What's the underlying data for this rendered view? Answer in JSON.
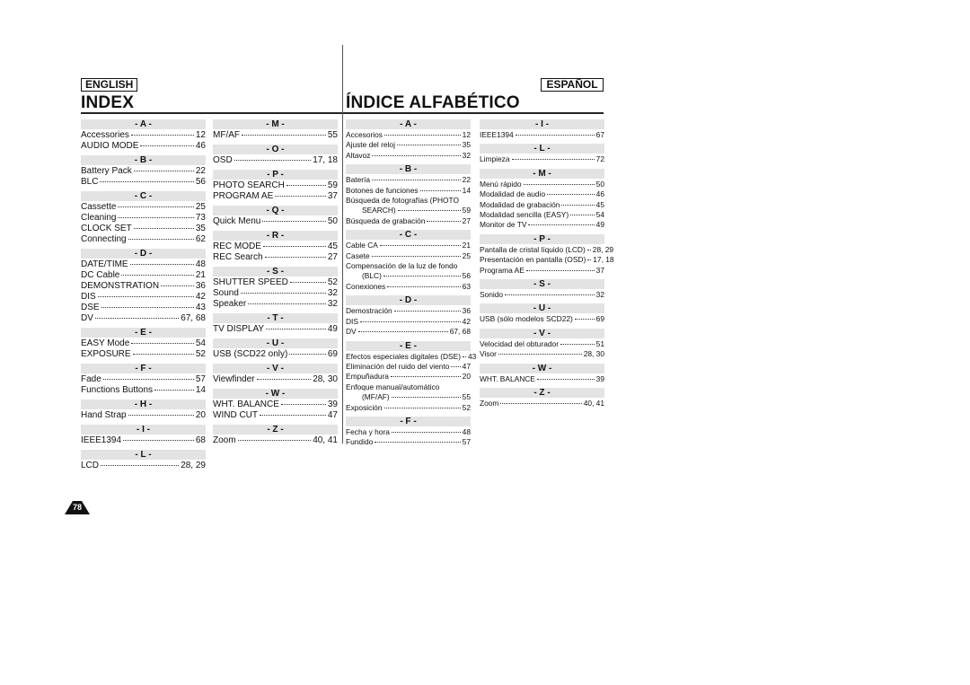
{
  "english": {
    "lang_label": "ENGLISH",
    "title": "INDEX",
    "columns": [
      [
        {
          "letter": "- A -",
          "items": [
            [
              "Accessories",
              "12"
            ],
            [
              "AUDIO MODE",
              "46"
            ]
          ]
        },
        {
          "letter": "- B -",
          "items": [
            [
              "Battery Pack",
              "22"
            ],
            [
              "BLC",
              "56"
            ]
          ]
        },
        {
          "letter": "- C -",
          "items": [
            [
              "Cassette",
              "25"
            ],
            [
              "Cleaning",
              "73"
            ],
            [
              "CLOCK SET",
              "35"
            ],
            [
              "Connecting",
              "62"
            ]
          ]
        },
        {
          "letter": "- D -",
          "items": [
            [
              "DATE/TIME",
              "48"
            ],
            [
              "DC Cable",
              "21"
            ],
            [
              "DEMONSTRATION",
              "36"
            ],
            [
              "DIS",
              "42"
            ],
            [
              "DSE",
              "43"
            ],
            [
              "DV",
              "67, 68"
            ]
          ]
        },
        {
          "letter": "- E -",
          "items": [
            [
              "EASY Mode",
              "54"
            ],
            [
              "EXPOSURE",
              "52"
            ]
          ]
        },
        {
          "letter": "- F -",
          "items": [
            [
              "Fade",
              "57"
            ],
            [
              "Functions Buttons",
              "14"
            ]
          ]
        },
        {
          "letter": "- H -",
          "items": [
            [
              "Hand Strap",
              "20"
            ]
          ]
        },
        {
          "letter": "- I -",
          "items": [
            [
              "IEEE1394",
              "68"
            ]
          ]
        },
        {
          "letter": "- L -",
          "items": [
            [
              "LCD",
              "28, 29"
            ]
          ]
        }
      ],
      [
        {
          "letter": "- M -",
          "items": [
            [
              "MF/AF",
              "55"
            ]
          ]
        },
        {
          "letter": "- O -",
          "items": [
            [
              "OSD",
              "17, 18"
            ]
          ]
        },
        {
          "letter": "- P -",
          "items": [
            [
              "PHOTO SEARCH",
              "59"
            ],
            [
              "PROGRAM AE",
              "37"
            ]
          ]
        },
        {
          "letter": "- Q -",
          "items": [
            [
              "Quick Menu",
              "50"
            ]
          ]
        },
        {
          "letter": "- R -",
          "items": [
            [
              "REC MODE",
              "45"
            ],
            [
              "REC Search",
              "27"
            ]
          ]
        },
        {
          "letter": "- S -",
          "items": [
            [
              "SHUTTER SPEED",
              "52"
            ],
            [
              "Sound",
              "32"
            ],
            [
              "Speaker",
              "32"
            ]
          ]
        },
        {
          "letter": "- T -",
          "items": [
            [
              "TV DISPLAY",
              "49"
            ]
          ]
        },
        {
          "letter": "- U -",
          "items": [
            [
              "USB (SCD22 only)",
              "69"
            ]
          ]
        },
        {
          "letter": "- V -",
          "items": [
            [
              "Viewfinder",
              "28, 30"
            ]
          ]
        },
        {
          "letter": "- W -",
          "items": [
            [
              "WHT. BALANCE",
              "39"
            ],
            [
              "WIND CUT",
              "47"
            ]
          ]
        },
        {
          "letter": "- Z -",
          "items": [
            [
              "Zoom",
              "40, 41"
            ]
          ]
        }
      ]
    ]
  },
  "espanol": {
    "lang_label": "ESPAÑOL",
    "title": "ÍNDICE ALFABÉTICO",
    "columns": [
      [
        {
          "letter": "- A -",
          "items": [
            [
              "Accesorios",
              "12"
            ],
            [
              "Ajuste del reloj",
              "35"
            ],
            [
              "Altavoz",
              "32"
            ]
          ]
        },
        {
          "letter": "- B -",
          "items": [
            [
              "Batería",
              "22"
            ],
            [
              "Botones de funciones",
              "14"
            ],
            [
              "Búsqueda de fotografías (PHOTO",
              "SEARCH)",
              "59"
            ],
            [
              "Búsqueda de grabación",
              "27"
            ]
          ]
        },
        {
          "letter": "- C -",
          "items": [
            [
              "Cable CA",
              "21"
            ],
            [
              "Casete",
              "25"
            ],
            [
              "Compensación de la luz de fondo",
              "(BLC)",
              "56"
            ],
            [
              "Conexiones",
              "63"
            ]
          ]
        },
        {
          "letter": "- D -",
          "items": [
            [
              "Demostración",
              "36"
            ],
            [
              "DIS",
              "42"
            ],
            [
              "DV",
              "67, 68"
            ]
          ]
        },
        {
          "letter": "- E -",
          "items": [
            [
              "Efectos especiales digitales (DSE)",
              "43"
            ],
            [
              "Eliminación del ruido del viento",
              "47"
            ],
            [
              "Empuñadura",
              "20"
            ],
            [
              "Enfoque manual/automático",
              "(MF/AF)",
              "55"
            ],
            [
              "Exposición",
              "52"
            ]
          ]
        },
        {
          "letter": "- F -",
          "items": [
            [
              "Fecha y hora",
              "48"
            ],
            [
              "Fundido",
              "57"
            ]
          ]
        }
      ],
      [
        {
          "letter": "- I -",
          "items": [
            [
              "IEEE1394",
              "67"
            ]
          ]
        },
        {
          "letter": "- L -",
          "items": [
            [
              "Limpieza",
              "72"
            ]
          ]
        },
        {
          "letter": "- M -",
          "items": [
            [
              "Menú rápido",
              "50"
            ],
            [
              "Modalidad de audio",
              "46"
            ],
            [
              "Modalidad de grabación",
              "45"
            ],
            [
              "Modalidad sencilla (EASY)",
              "54"
            ],
            [
              "Monitor de TV",
              "49"
            ]
          ]
        },
        {
          "letter": "- P -",
          "items": [
            [
              "Pantalla de cristal líquido (LCD)",
              "28, 29"
            ],
            [
              "Presentación en pantalla (OSD)",
              "17, 18"
            ],
            [
              "Programa AE",
              "37"
            ]
          ]
        },
        {
          "letter": "- S -",
          "items": [
            [
              "Sonido",
              "32"
            ]
          ]
        },
        {
          "letter": "- U -",
          "items": [
            [
              "USB (sólo modelos SCD22)",
              "69"
            ]
          ]
        },
        {
          "letter": "- V -",
          "items": [
            [
              "Velocidad del obturador",
              "51"
            ],
            [
              "Visor",
              "28, 30"
            ]
          ]
        },
        {
          "letter": "- W -",
          "items": [
            [
              "WHT. BALANCE",
              "39"
            ]
          ]
        },
        {
          "letter": "- Z -",
          "items": [
            [
              "Zoom",
              "40, 41"
            ]
          ]
        }
      ]
    ]
  },
  "page_number": "78"
}
